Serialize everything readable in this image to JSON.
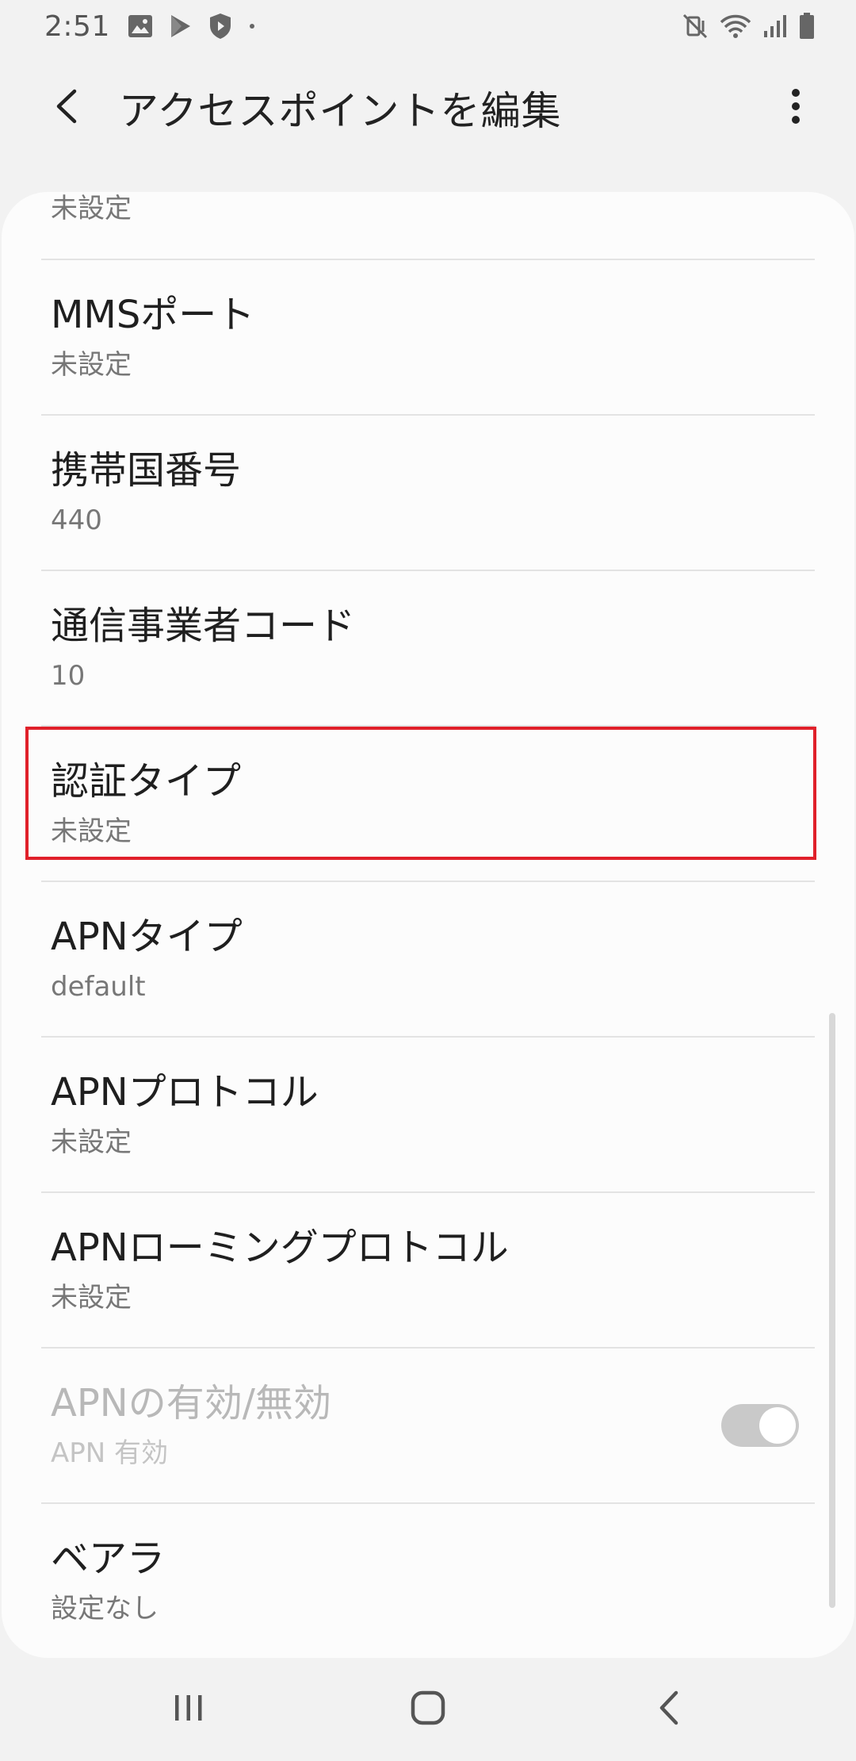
{
  "status_bar": {
    "time": "2:51",
    "left_icons": [
      "gallery-icon",
      "play-store-icon",
      "shield-icon",
      "dot-icon"
    ],
    "right_icons": [
      "mute-vibrate-icon",
      "wifi-icon",
      "signal-icon",
      "battery-icon"
    ]
  },
  "app_bar": {
    "title": "アクセスポイントを編集",
    "back_icon": "chevron-left-icon",
    "more_icon": "more-vertical-icon"
  },
  "list": {
    "items": [
      {
        "title": "",
        "value": "未設定"
      },
      {
        "title": "MMSポート",
        "value": "未設定"
      },
      {
        "title": "携帯国番号",
        "value": "440"
      },
      {
        "title": "通信事業者コード",
        "value": "10"
      },
      {
        "title": "認証タイプ",
        "value": "未設定",
        "highlighted": true
      },
      {
        "title": "APNタイプ",
        "value": "default"
      },
      {
        "title": "APNプロトコル",
        "value": "未設定"
      },
      {
        "title": "APNローミングプロトコル",
        "value": "未設定"
      },
      {
        "title": "APNの有効/無効",
        "value": "APN 有効",
        "disabled": true,
        "toggle": "on"
      },
      {
        "title": "ベアラ",
        "value": "設定なし"
      }
    ]
  },
  "highlight_color": "#e0202a",
  "nav_bar": {
    "icons": [
      "recents-icon",
      "home-icon",
      "back-icon"
    ]
  }
}
